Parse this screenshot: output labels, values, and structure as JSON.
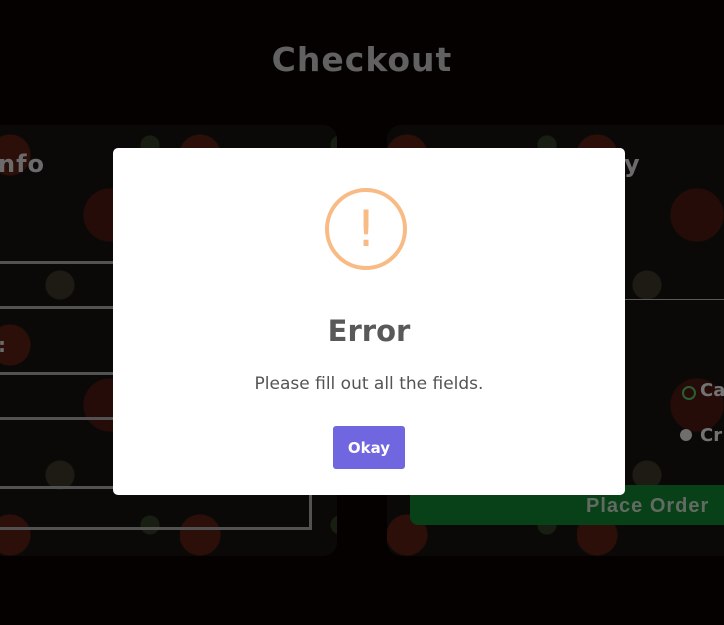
{
  "page": {
    "title": "Checkout"
  },
  "left_card": {
    "heading": "nfo",
    "colon_label": ":"
  },
  "right_card": {
    "heading": "y",
    "payment_options": [
      {
        "label": "Ca",
        "selected": true
      },
      {
        "label": "Cr",
        "selected": false
      }
    ],
    "place_order_label": "Place Order"
  },
  "modal": {
    "icon": "warning-icon",
    "icon_glyph": "!",
    "icon_color": "#f8bb86",
    "title": "Error",
    "message": "Please fill out all the fields.",
    "confirm_label": "Okay",
    "confirm_color": "#7066e0"
  }
}
